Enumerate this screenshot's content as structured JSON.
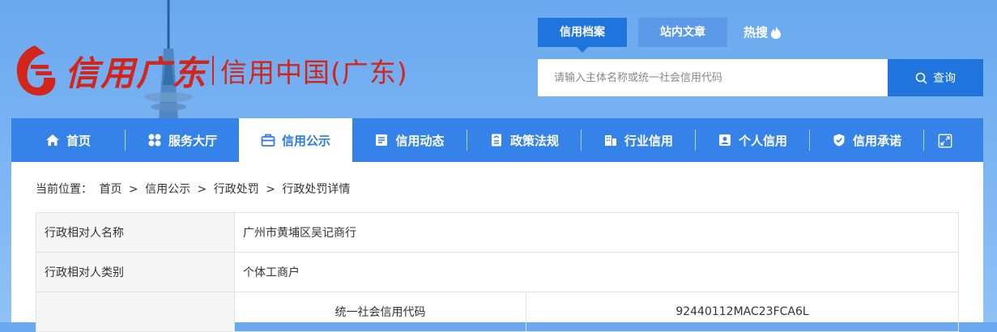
{
  "logo": {
    "brand_cn": "信用广东",
    "brand_text": "信用中国(广东)"
  },
  "search": {
    "tabs": [
      {
        "label": "信用档案",
        "active": true
      },
      {
        "label": "站内文章",
        "active": false
      }
    ],
    "hot_label": "热搜",
    "placeholder": "请输入主体名称或统一社会信用代码",
    "button_label": "查询"
  },
  "nav": {
    "items": [
      {
        "label": "首页",
        "icon": "home-icon"
      },
      {
        "label": "服务大厅",
        "icon": "grid-icon"
      },
      {
        "label": "信用公示",
        "icon": "briefcase-icon",
        "active": true
      },
      {
        "label": "信用动态",
        "icon": "news-icon"
      },
      {
        "label": "政策法规",
        "icon": "document-icon"
      },
      {
        "label": "行业信用",
        "icon": "building-icon"
      },
      {
        "label": "个人信用",
        "icon": "id-card-icon"
      },
      {
        "label": "信用承诺",
        "icon": "shield-icon"
      }
    ],
    "expand_icon": "expand-icon"
  },
  "breadcrumb": {
    "prefix": "当前位置：",
    "items": [
      "首页",
      "信用公示",
      "行政处罚",
      "行政处罚详情"
    ],
    "separator": ">"
  },
  "detail": {
    "rows": [
      {
        "label": "行政相对人名称",
        "value": "广州市黄埔区吴记商行"
      },
      {
        "label": "行政相对人类别",
        "value": "个体工商户"
      }
    ],
    "sub_row": {
      "label": "统一社会信用代码",
      "value": "92440112MAC23FCA6L"
    }
  },
  "colors": {
    "brand_red": "#d2261c",
    "primary_blue": "#1f74de",
    "nav_blue": "#3583e8"
  }
}
